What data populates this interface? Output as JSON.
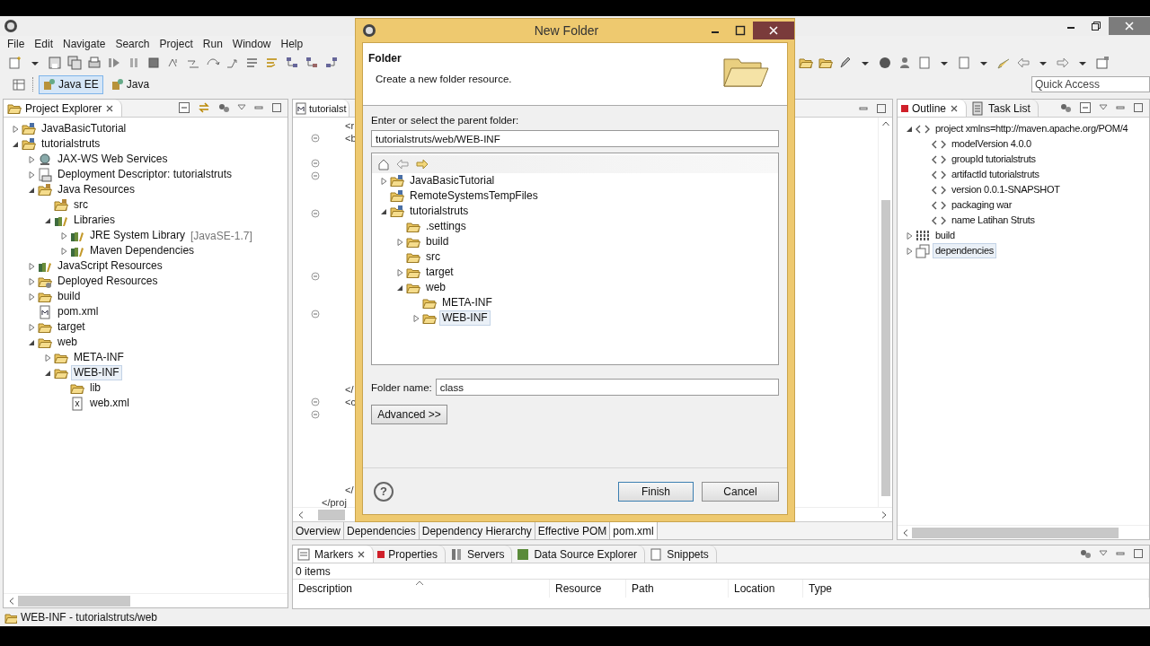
{
  "menu": [
    "File",
    "Edit",
    "Navigate",
    "Search",
    "Project",
    "Run",
    "Window",
    "Help"
  ],
  "perspectives": [
    {
      "label": "Java EE",
      "selected": true
    },
    {
      "label": "Java",
      "selected": false
    }
  ],
  "quick_access": {
    "placeholder": "Quick Access"
  },
  "project_explorer": {
    "tab": "Project Explorer",
    "tree": [
      {
        "label": "JavaBasicTutorial",
        "kind": "project",
        "expanded": false,
        "selected": false
      },
      {
        "label": "tutorialstruts",
        "kind": "project",
        "expanded": true,
        "selected": false,
        "children": [
          {
            "label": "JAX-WS Web Services",
            "kind": "service",
            "expanded": false,
            "selected": false
          },
          {
            "label": "Deployment Descriptor: tutorialstruts",
            "kind": "descriptor",
            "expanded": false,
            "selected": false
          },
          {
            "label": "Java Resources",
            "kind": "source",
            "expanded": true,
            "selected": false,
            "children": [
              {
                "label": "src",
                "kind": "source",
                "selected": false
              },
              {
                "label": "Libraries",
                "kind": "library",
                "expanded": true,
                "selected": false,
                "children": [
                  {
                    "label": "JRE System Library",
                    "detail": "[JavaSE-1.7]",
                    "kind": "library",
                    "expanded": false,
                    "selected": false
                  },
                  {
                    "label": "Maven Dependencies",
                    "kind": "library",
                    "expanded": false,
                    "selected": false
                  }
                ]
              }
            ]
          },
          {
            "label": "JavaScript Resources",
            "kind": "library",
            "expanded": false,
            "selected": false
          },
          {
            "label": "Deployed Resources",
            "kind": "deployed",
            "expanded": false,
            "selected": false
          },
          {
            "label": "build",
            "kind": "folder",
            "expanded": false,
            "selected": false
          },
          {
            "label": "pom.xml",
            "kind": "file",
            "selected": false
          },
          {
            "label": "target",
            "kind": "folder",
            "expanded": false,
            "selected": false
          },
          {
            "label": "web",
            "kind": "folder",
            "expanded": true,
            "selected": false,
            "children": [
              {
                "label": "META-INF",
                "kind": "folder",
                "expanded": false,
                "selected": false
              },
              {
                "label": "WEB-INF",
                "kind": "folder",
                "expanded": true,
                "selected": true,
                "children": [
                  {
                    "label": "lib",
                    "kind": "folder",
                    "selected": false
                  },
                  {
                    "label": "web.xml",
                    "kind": "xml",
                    "selected": false
                  }
                ]
              }
            ]
          }
        ]
      }
    ]
  },
  "editor": {
    "tab": "tutorialst",
    "lines": [
      {
        "text": "<r",
        "fold": false
      },
      {
        "text": "<b",
        "fold": true
      },
      {
        "fold": false
      },
      {
        "fold": true
      },
      {
        "fold": true
      },
      {
        "fold": false
      },
      {
        "fold": false
      },
      {
        "fold": true
      },
      {
        "fold": false
      },
      {
        "fold": false
      },
      {
        "fold": false
      },
      {
        "fold": false
      },
      {
        "fold": true
      },
      {
        "fold": false
      },
      {
        "fold": false
      },
      {
        "fold": true
      },
      {
        "fold": false
      },
      {
        "fold": false
      },
      {
        "fold": false
      },
      {
        "fold": false
      },
      {
        "fold": false
      },
      {
        "text": "</",
        "fold": false
      },
      {
        "text": "<c",
        "fold": true
      },
      {
        "fold": true
      },
      {
        "fold": false
      },
      {
        "fold": false
      },
      {
        "fold": false
      },
      {
        "fold": false
      },
      {
        "fold": false
      },
      {
        "text": "</",
        "fold": false
      },
      {
        "text": "</proj",
        "outdent": true,
        "fold": false
      }
    ],
    "bottom_tabs": [
      {
        "label": "Overview",
        "selected": false
      },
      {
        "label": "Dependencies",
        "selected": false
      },
      {
        "label": "Dependency Hierarchy",
        "selected": false
      },
      {
        "label": "Effective POM",
        "selected": false
      },
      {
        "label": "pom.xml",
        "selected": true
      }
    ]
  },
  "outline": {
    "tabs": [
      {
        "label": "Outline",
        "selected": true
      },
      {
        "label": "Task List",
        "selected": false
      }
    ],
    "tree": [
      {
        "label": "project xmlns=http://maven.apache.org/POM/4",
        "kind": "element",
        "expanded": true,
        "selected": false,
        "children": [
          {
            "label": "modelVersion  4.0.0",
            "kind": "element",
            "selected": false
          },
          {
            "label": "groupId  tutorialstruts",
            "kind": "element",
            "selected": false
          },
          {
            "label": "artifactId  tutorialstruts",
            "kind": "element",
            "selected": false
          },
          {
            "label": "version  0.0.1-SNAPSHOT",
            "kind": "element",
            "selected": false
          },
          {
            "label": "packaging  war",
            "kind": "element",
            "selected": false
          },
          {
            "label": "name  Latihan Struts",
            "kind": "element",
            "selected": false
          }
        ]
      },
      {
        "label": "build",
        "kind": "grid",
        "expanded": false,
        "selected": false
      },
      {
        "label": "dependencies",
        "kind": "box",
        "expanded": false,
        "selected": true
      }
    ]
  },
  "markers": {
    "tabs": [
      {
        "label": "Markers",
        "selected": true
      },
      {
        "label": "Properties",
        "selected": false
      },
      {
        "label": "Servers",
        "selected": false
      },
      {
        "label": "Data Source Explorer",
        "selected": false
      },
      {
        "label": "Snippets",
        "selected": false
      }
    ],
    "count": "0 items",
    "columns": [
      "Description",
      "Resource",
      "Path",
      "Location",
      "Type"
    ]
  },
  "status_bar": "WEB-INF - tutorialstruts/web",
  "dialog": {
    "title": "New Folder",
    "heading": "Folder",
    "description": "Create a new folder resource.",
    "parent_label": "Enter or select the parent folder:",
    "parent_value": "tutorialstruts/web/WEB-INF",
    "tree": [
      {
        "label": "JavaBasicTutorial",
        "kind": "project",
        "expanded": false,
        "selected": false
      },
      {
        "label": "RemoteSystemsTempFiles",
        "kind": "project",
        "selected": false
      },
      {
        "label": "tutorialstruts",
        "kind": "project",
        "expanded": true,
        "selected": false,
        "children": [
          {
            "label": ".settings",
            "kind": "folder",
            "selected": false
          },
          {
            "label": "build",
            "kind": "folder",
            "expanded": false,
            "selected": false
          },
          {
            "label": "src",
            "kind": "folder",
            "selected": false
          },
          {
            "label": "target",
            "kind": "folder",
            "expanded": false,
            "selected": false
          },
          {
            "label": "web",
            "kind": "folder",
            "expanded": true,
            "selected": false,
            "children": [
              {
                "label": "META-INF",
                "kind": "folder",
                "selected": false
              },
              {
                "label": "WEB-INF",
                "kind": "folder",
                "expanded": false,
                "selected": true
              }
            ]
          }
        ]
      }
    ],
    "name_label": "Folder name:",
    "name_value": "class",
    "advanced": "Advanced >>",
    "help": "?",
    "finish": "Finish",
    "cancel": "Cancel"
  }
}
